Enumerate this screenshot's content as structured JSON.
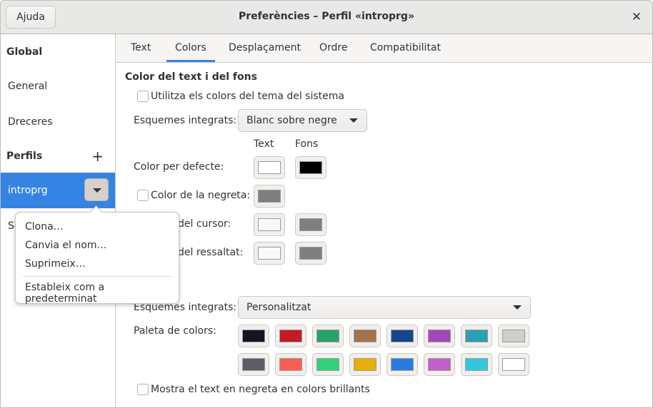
{
  "window": {
    "title": "Preferències – Perfil «introprg»",
    "help_label": "Ajuda"
  },
  "sidebar": {
    "global_header": "Global",
    "items": [
      {
        "label": "General"
      },
      {
        "label": "Dreceres"
      }
    ],
    "profiles_header": "Perfils",
    "selected_profile": "introprg",
    "partial_item": "Se"
  },
  "popover": {
    "items": [
      {
        "label": "Clona…"
      },
      {
        "label": "Canvia el nom…"
      },
      {
        "label": "Suprimeix…"
      },
      {
        "label": "Estableix com a predeterminat"
      }
    ]
  },
  "tabs": [
    {
      "label": "Text"
    },
    {
      "label": "Colors",
      "active": true
    },
    {
      "label": "Desplaçament"
    },
    {
      "label": "Ordre"
    },
    {
      "label": "Compatibilitat"
    }
  ],
  "colors": {
    "section_title": "Color del text i del fons",
    "use_system": {
      "label": "Utilitza els colors del tema del sistema",
      "checked": false
    },
    "schemes_label": "Esquemes integrats:",
    "scheme_value": "Blanc sobre negre",
    "col_text": "Text",
    "col_bg": "Fons",
    "default_label": "Color per defecte:",
    "default_text": "#ffffff",
    "default_bg": "#000000",
    "bold_label": "Color de la negreta:",
    "bold_checked": false,
    "bold_color": "#7f7f7f",
    "cursor_label": "del cursor:",
    "cursor_text": "#f9f9f9",
    "cursor_bg": "#7f7f7f",
    "highlight_label": "del ressaltat:",
    "highlight_text": "#f9f9f9",
    "highlight_bg": "#7f7f7f"
  },
  "palette": {
    "schemes_label": "Esquemes integrats:",
    "scheme_value": "Personalitzat",
    "palette_label": "Paleta de colors:",
    "row1": [
      "#171421",
      "#c01c28",
      "#26a269",
      "#a2734c",
      "#12488b",
      "#a347ba",
      "#2aa1b3",
      "#d0cfcc"
    ],
    "row2": [
      "#5e5c64",
      "#f66151",
      "#33d17a",
      "#e9ad0c",
      "#2a7bde",
      "#c061cb",
      "#33c7de",
      "#ffffff"
    ],
    "bold_bright": {
      "label": "Mostra el text en negreta en colors brillants",
      "checked": false
    }
  }
}
